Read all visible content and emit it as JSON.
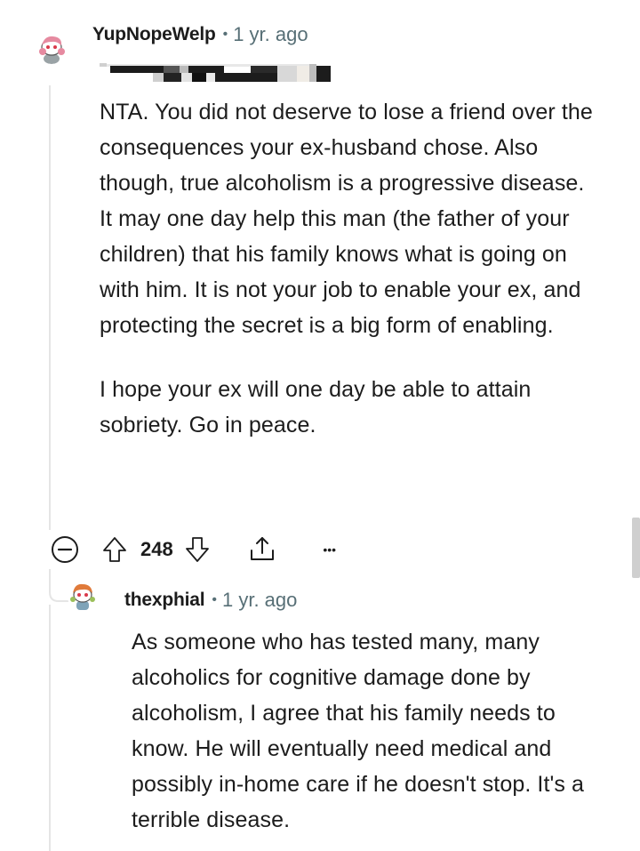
{
  "comment1": {
    "username": "YupNopeWelp",
    "separator": "•",
    "timestamp": "1 yr. ago",
    "avatar_icon": "snoo-avatar-pink-hair",
    "paragraphs": [
      "NTA. You did not deserve to lose a friend over the consequences your ex-husband chose. Also though, true alcoholism is a progressive disease. It may one day help this man (the father of your children) that his family knows what is going on with him. It is not your job to enable your ex, and protecting the secret is a big form of enabling.",
      "I hope your ex will one day be able to attain sobriety. Go in peace."
    ],
    "actions": {
      "collapse_icon": "minus-circle-icon",
      "upvote_icon": "upvote-arrow-icon",
      "vote_count": "248",
      "downvote_icon": "downvote-arrow-icon",
      "share_icon": "share-icon",
      "more_label": "•••"
    }
  },
  "comment2": {
    "username": "thexphial",
    "separator": "•",
    "timestamp": "1 yr. ago",
    "avatar_icon": "snoo-avatar-orange-hair",
    "paragraphs": [
      "As someone who has tested many, many alcoholics for cognitive damage done by alcoholism, I agree that his family needs to know. He will eventually need medical and possibly in-home care if he doesn't stop. It's a terrible disease."
    ]
  },
  "colors": {
    "text": "#1c1c1c",
    "meta": "#576f76",
    "thread_line": "#e5e5e5",
    "icon": "#1c1c1c"
  }
}
